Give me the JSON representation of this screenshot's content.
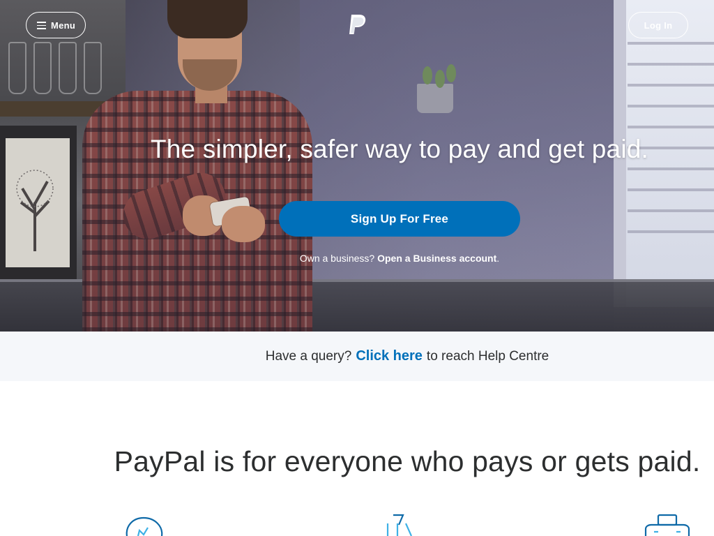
{
  "header": {
    "menu_label": "Menu",
    "login_label": "Log In",
    "logo_icon": "paypal-logo-icon"
  },
  "hero": {
    "headline": "The simpler, safer way to pay and get paid.",
    "signup_label": "Sign Up For Free",
    "business_prefix": "Own a business?",
    "business_link": "Open a Business account",
    "business_suffix": "."
  },
  "help": {
    "prefix": "Have a query?",
    "link": "Click here",
    "suffix": "to reach Help Centre"
  },
  "main": {
    "section_title": "PayPal is for everyone who pays or gets paid.",
    "feature_icons": [
      "handshake-heart-icon",
      "shop-cart-icon",
      "briefcase-icon"
    ]
  },
  "colors": {
    "brand_blue": "#0070ba",
    "help_band_bg": "#f5f7fa",
    "text_dark": "#2c2e2f"
  }
}
